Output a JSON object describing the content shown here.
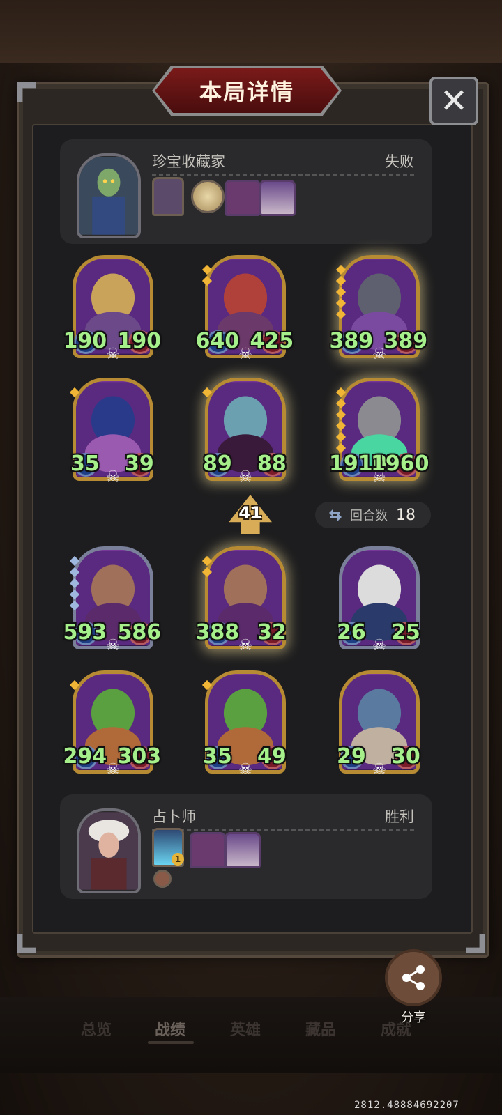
{
  "header": {
    "title": "本局详情",
    "close_symbol": "✕"
  },
  "opponent": {
    "name": "珍宝收藏家",
    "result": "失败",
    "items": [
      "framed-portrait-item-icon",
      "fan-coin-item-icon",
      "cart-item-icon",
      "feast-table-item-icon"
    ]
  },
  "opponent_board": [
    {
      "attack": "190",
      "health": "190",
      "icon": "robot-diver-card-art",
      "frame": "gold",
      "glow": false,
      "gems": 0
    },
    {
      "attack": "640",
      "health": "425",
      "icon": "dragon-blade-card-art",
      "frame": "gold",
      "glow": false,
      "gems": 2
    },
    {
      "attack": "389",
      "health": "389",
      "icon": "gatling-robot-card-art",
      "frame": "gold",
      "glow": true,
      "gems": 5
    },
    {
      "attack": "35",
      "health": "39",
      "icon": "moon-sorceress-card-art",
      "frame": "gold",
      "glow": false,
      "gems": 1
    },
    {
      "attack": "89",
      "health": "88",
      "icon": "vampire-lady-card-art",
      "frame": "gold",
      "glow": true,
      "gems": 1
    },
    {
      "attack": "1910",
      "health": "1960",
      "icon": "dragon-breath-card-art",
      "frame": "gold",
      "glow": true,
      "gems": 6
    }
  ],
  "middle": {
    "tier": "41",
    "round_label": "回合数",
    "round_value": "18"
  },
  "player_board": [
    {
      "attack": "593",
      "health": "586",
      "icon": "missile-card-art",
      "frame": "silver",
      "glow": false,
      "gems": 5
    },
    {
      "attack": "388",
      "health": "32",
      "icon": "missile-card-art",
      "frame": "gold",
      "glow": true,
      "gems": 2
    },
    {
      "attack": "26",
      "health": "25",
      "icon": "bomber-card-art",
      "frame": "silver",
      "glow": false,
      "gems": 0
    },
    {
      "attack": "294",
      "health": "303",
      "icon": "dragon-rider-card-art",
      "frame": "gold",
      "glow": false,
      "gems": 1
    },
    {
      "attack": "35",
      "health": "49",
      "icon": "dragon-rider-card-art",
      "frame": "gold",
      "glow": false,
      "gems": 1
    },
    {
      "attack": "29",
      "health": "30",
      "icon": "yeti-beast-card-art",
      "frame": "gold",
      "glow": false,
      "gems": 0
    }
  ],
  "player": {
    "name": "占卜师",
    "result": "胜利",
    "item_count": "1",
    "items": [
      "crystal-card-item-icon",
      "cart-item-icon",
      "feast-table-item-icon",
      "coin-item-icon"
    ]
  },
  "share_label": "分享",
  "tabs": [
    "总览",
    "战绩",
    "英雄",
    "藏品",
    "成就"
  ],
  "active_tab": "战绩",
  "coordinates_readout": "2812.48884692207",
  "colors": {
    "stat_green": "#a6f08c",
    "title_red": "#7a1a1a",
    "gold_frame": "#b68b33",
    "silver_frame": "#7a809a"
  }
}
